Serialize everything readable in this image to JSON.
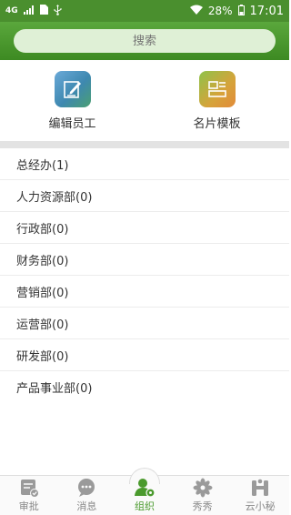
{
  "status_bar": {
    "network": "4G",
    "battery": "28%",
    "time": "17:01"
  },
  "search": {
    "placeholder": "搜索"
  },
  "shortcuts": [
    {
      "label": "编辑员工",
      "icon": "edit-icon"
    },
    {
      "label": "名片模板",
      "icon": "card-template-icon"
    }
  ],
  "departments": [
    {
      "label": "总经办(1)"
    },
    {
      "label": "人力资源部(0)"
    },
    {
      "label": "行政部(0)"
    },
    {
      "label": "财务部(0)"
    },
    {
      "label": "营销部(0)"
    },
    {
      "label": "运营部(0)"
    },
    {
      "label": "研发部(0)"
    },
    {
      "label": "产品事业部(0)"
    }
  ],
  "tabs": [
    {
      "label": "审批",
      "icon": "approval-icon"
    },
    {
      "label": "消息",
      "icon": "message-icon"
    },
    {
      "label": "组织",
      "icon": "organization-icon",
      "active": true
    },
    {
      "label": "秀秀",
      "icon": "flower-icon"
    },
    {
      "label": "云小秘",
      "icon": "assistant-icon"
    }
  ],
  "colors": {
    "header_green": "#4a8f2e",
    "active_tab": "#4a9a2d",
    "divider": "#e3e3e3"
  }
}
